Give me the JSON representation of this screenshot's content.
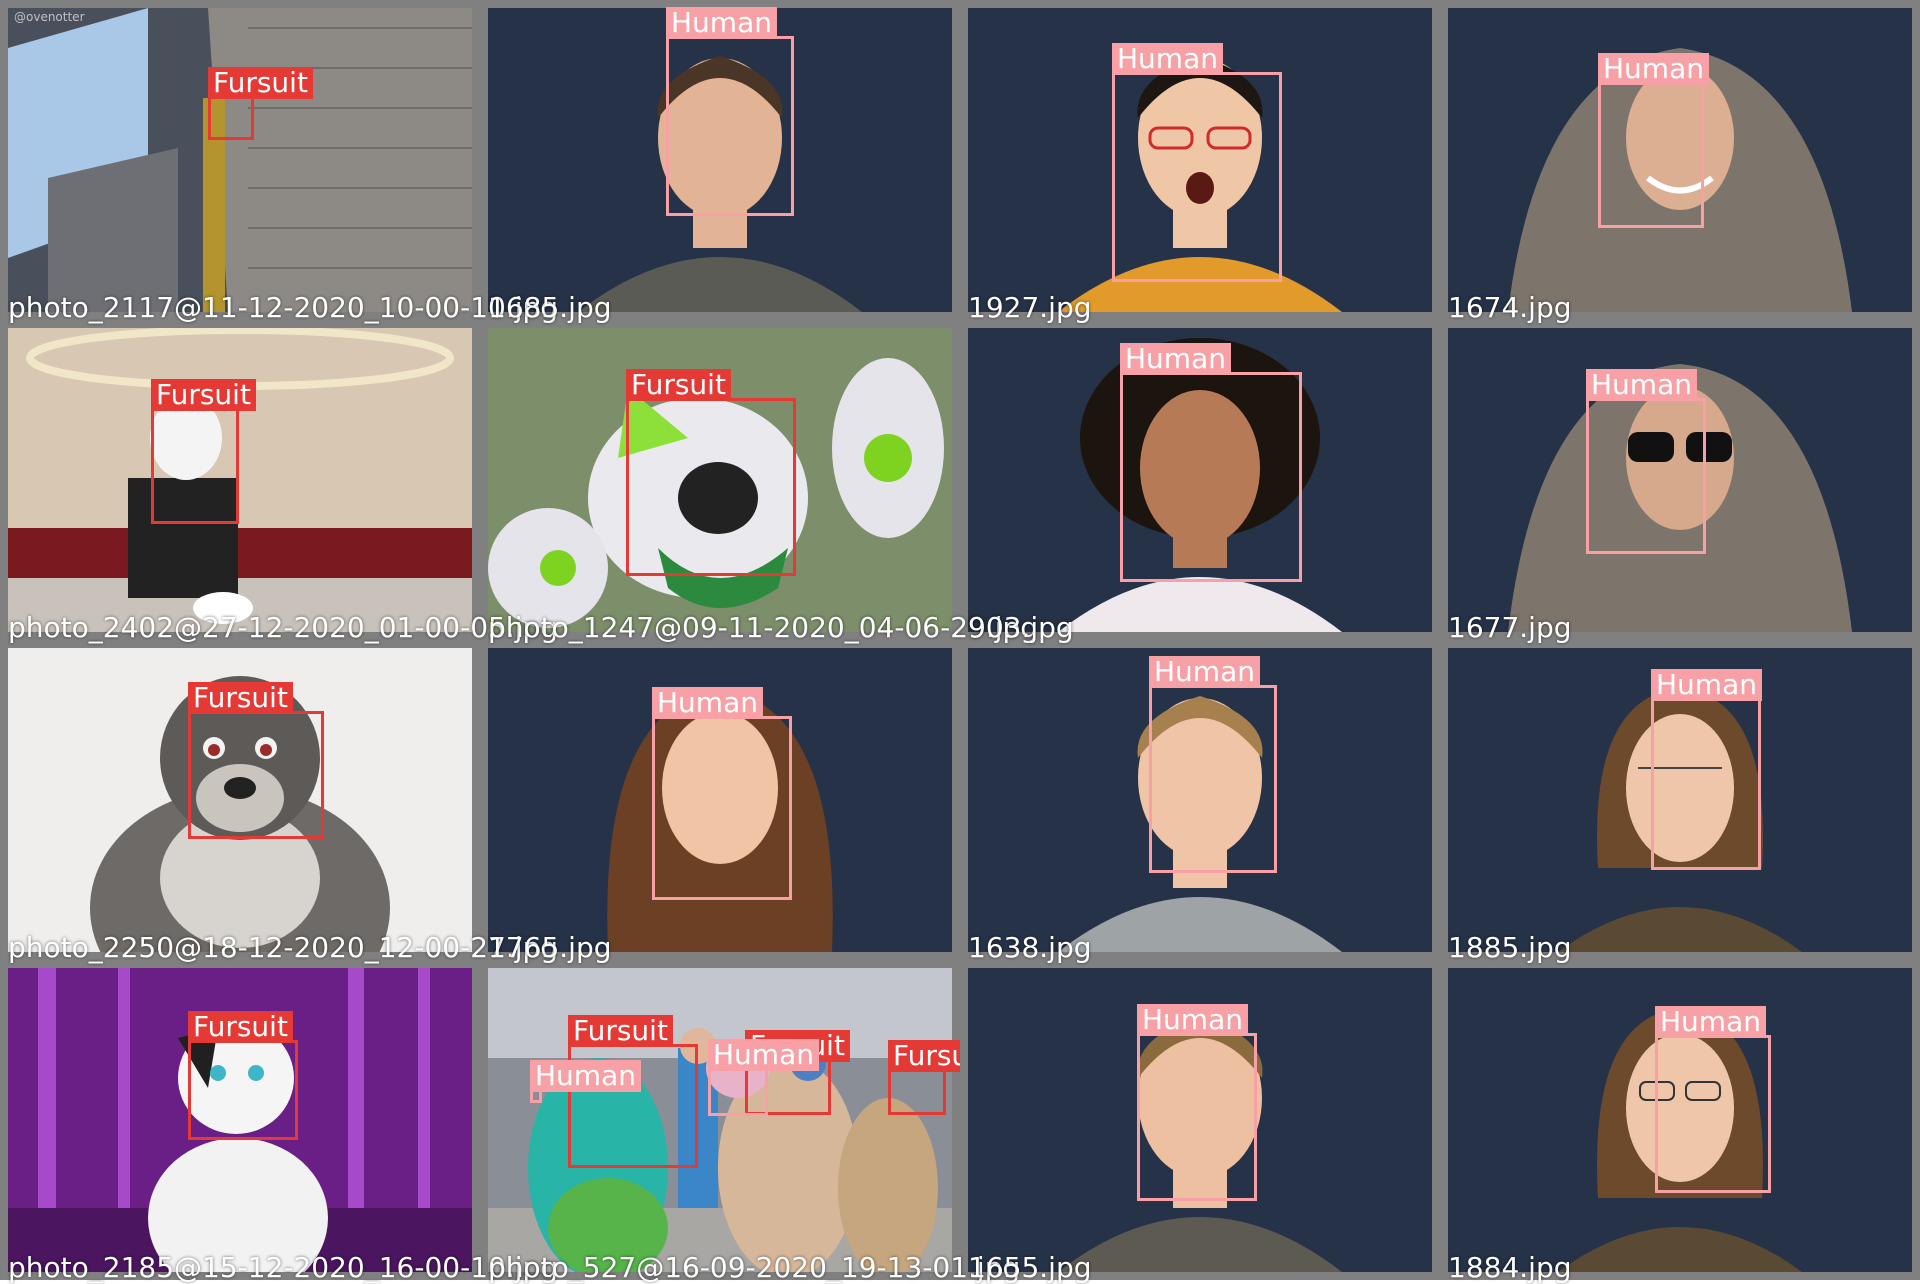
{
  "class_colors": {
    "Fursuit": "#e53935",
    "Human": "#f7a1a6"
  },
  "tiles": [
    {
      "filename": "photo_2117@11-12-2020_10-00-10.jpg",
      "watermark": "@ovenotter",
      "scene": "atrium",
      "detections": [
        {
          "label": "Fursuit"
        }
      ]
    },
    {
      "filename": "1685.jpg",
      "scene": "studio-man",
      "detections": [
        {
          "label": "Human"
        }
      ]
    },
    {
      "filename": "1927.jpg",
      "scene": "studio-woman-glasses",
      "detections": [
        {
          "label": "Human"
        }
      ]
    },
    {
      "filename": "1674.jpg",
      "scene": "studio-hijab",
      "detections": [
        {
          "label": "Human"
        }
      ]
    },
    {
      "filename": "photo_2402@27-12-2020_01-00-05.jpg",
      "scene": "hall",
      "detections": [
        {
          "label": "Fursuit"
        }
      ]
    },
    {
      "filename": "photo_1247@09-11-2020_04-06-29.jpg",
      "scene": "green-fursuit",
      "detections": [
        {
          "label": "Fursuit"
        }
      ]
    },
    {
      "filename": "903.jpg",
      "scene": "studio-curly",
      "detections": [
        {
          "label": "Human"
        }
      ]
    },
    {
      "filename": "1677.jpg",
      "scene": "studio-hijab-sunglasses",
      "detections": [
        {
          "label": "Human"
        }
      ]
    },
    {
      "filename": "photo_2250@18-12-2020_12-00-27.jpg",
      "scene": "wolf-white",
      "detections": [
        {
          "label": "Fursuit"
        }
      ]
    },
    {
      "filename": "1765.jpg",
      "scene": "studio-woman-long-hair",
      "detections": [
        {
          "label": "Human"
        }
      ]
    },
    {
      "filename": "1638.jpg",
      "scene": "studio-young-man",
      "detections": [
        {
          "label": "Human"
        }
      ]
    },
    {
      "filename": "1885.jpg",
      "scene": "studio-woman-glasses-eyes-closed",
      "detections": [
        {
          "label": "Human"
        }
      ]
    },
    {
      "filename": "photo_2185@15-12-2020_16-00-10.jpg",
      "scene": "purple-forest",
      "detections": [
        {
          "label": "Fursuit"
        }
      ]
    },
    {
      "filename": "photo_527@16-09-2020_19-13-01.jpg",
      "scene": "convention-crowd",
      "detections": [
        {
          "label": "Fursuit"
        },
        {
          "label": "Human"
        },
        {
          "label": "Fursuit"
        },
        {
          "label": "Human"
        },
        {
          "label": "Fursuit"
        }
      ]
    },
    {
      "filename": "1655.jpg",
      "scene": "studio-man-eyes-closed",
      "detections": [
        {
          "label": "Human"
        }
      ]
    },
    {
      "filename": "1884.jpg",
      "scene": "studio-woman-smiling-glasses",
      "detections": [
        {
          "label": "Human"
        }
      ]
    }
  ]
}
